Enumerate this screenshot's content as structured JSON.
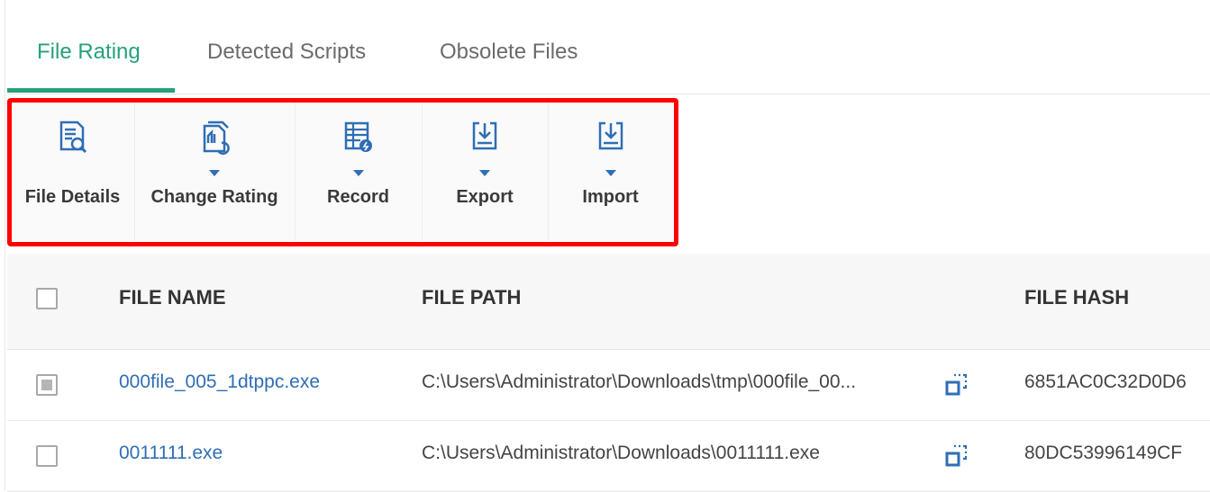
{
  "tabs": [
    {
      "label": "File Rating",
      "active": true
    },
    {
      "label": "Detected Scripts",
      "active": false
    },
    {
      "label": "Obsolete Files",
      "active": false
    }
  ],
  "toolbar": {
    "items": [
      {
        "label": "File Details",
        "icon": "file-details-icon",
        "has_dropdown": false
      },
      {
        "label": "Change Rating",
        "icon": "change-rating-icon",
        "has_dropdown": true
      },
      {
        "label": "Record",
        "icon": "record-icon",
        "has_dropdown": true
      },
      {
        "label": "Export",
        "icon": "export-icon",
        "has_dropdown": true
      },
      {
        "label": "Import",
        "icon": "import-icon",
        "has_dropdown": true
      }
    ]
  },
  "table": {
    "columns": [
      "FILE NAME",
      "FILE PATH",
      "FILE HASH"
    ],
    "rows": [
      {
        "checked": "partial",
        "file_name": "000file_005_1dtppc.exe",
        "file_path": "C:\\Users\\Administrator\\Downloads\\tmp\\000file_00...",
        "file_hash": "6851AC0C32D0D6"
      },
      {
        "checked": "unchecked",
        "file_name": "0011111.exe",
        "file_path": "C:\\Users\\Administrator\\Downloads\\0011111.exe",
        "file_hash": "80DC53996149CF"
      }
    ]
  },
  "colors": {
    "accent": "#26a17b",
    "link": "#2f6eb5",
    "highlight": "#ff0000"
  }
}
